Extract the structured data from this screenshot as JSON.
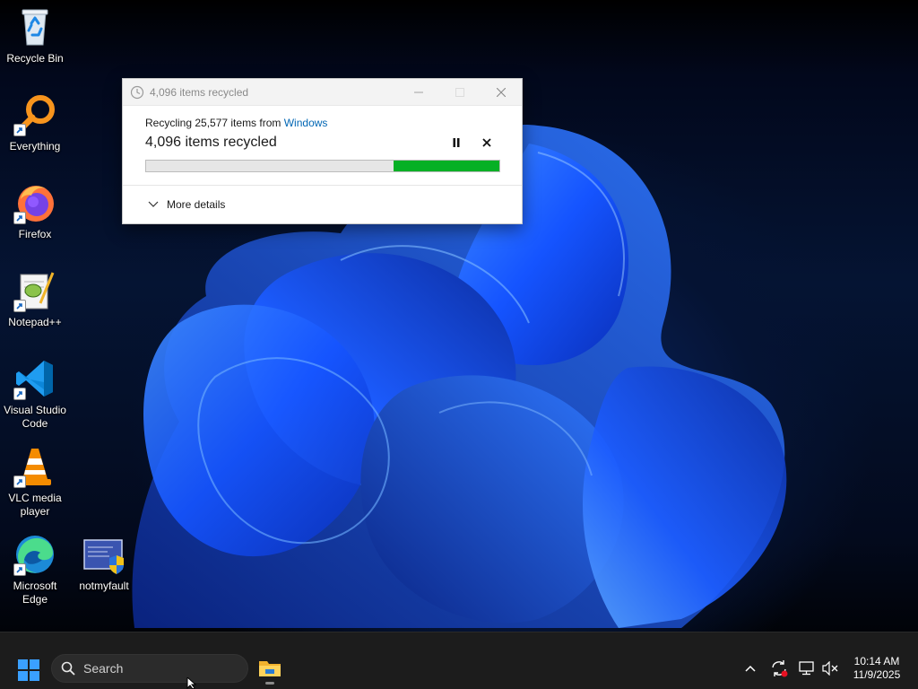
{
  "desktop": {
    "icons": [
      {
        "label": "Recycle Bin",
        "icon": "recycle-bin-icon",
        "shortcut": false
      },
      {
        "label": "Everything",
        "icon": "everything-search-icon",
        "shortcut": true
      },
      {
        "label": "Firefox",
        "icon": "firefox-icon",
        "shortcut": true
      },
      {
        "label": "Notepad++",
        "icon": "notepad-plus-plus-icon",
        "shortcut": true
      },
      {
        "label": "Visual Studio\nCode",
        "icon": "vscode-icon",
        "shortcut": true
      },
      {
        "label": "VLC media\nplayer",
        "icon": "vlc-icon",
        "shortcut": true
      },
      {
        "label": "Microsoft\nEdge",
        "icon": "edge-icon",
        "shortcut": true
      },
      {
        "label": "notmyfault",
        "icon": "notmyfault-icon",
        "shortcut": false
      }
    ]
  },
  "dialog": {
    "title": "4,096 items recycled",
    "from_prefix": "Recycling 25,577 items from ",
    "from_source": "Windows",
    "status": "4,096 items recycled",
    "progress_fraction": 0.3,
    "more_details": "More details",
    "accent_color": "#06b025"
  },
  "taskbar": {
    "search_placeholder": "Search",
    "clock_time": "10:14 AM",
    "clock_date": "11/9/2025"
  }
}
